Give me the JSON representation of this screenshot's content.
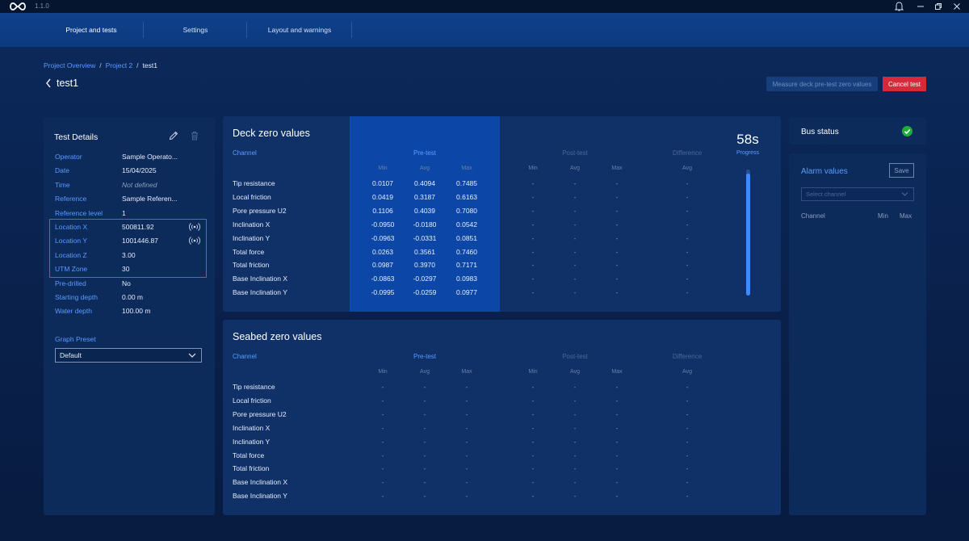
{
  "app": {
    "version": "1.1.0"
  },
  "nav": {
    "tabs": [
      {
        "label": "Project and tests"
      },
      {
        "label": "Settings"
      },
      {
        "label": "Layout and warnings"
      }
    ]
  },
  "breadcrumb": {
    "items": [
      "Project Overview",
      "Project 2",
      "test1"
    ]
  },
  "page": {
    "title": "test1"
  },
  "actions": {
    "measure_label": "Measure deck pre-test zero values",
    "cancel_label": "Cancel test"
  },
  "details": {
    "title": "Test Details",
    "rows": [
      {
        "label": "Operator",
        "value": "Sample Operato..."
      },
      {
        "label": "Date",
        "value": "15/04/2025"
      },
      {
        "label": "Time",
        "value": "Not defined"
      },
      {
        "label": "Reference",
        "value": "Sample Referen..."
      },
      {
        "label": "Reference level",
        "value": "1"
      },
      {
        "label": "Location X",
        "value": "500811.92"
      },
      {
        "label": "Location Y",
        "value": "1001446.87"
      },
      {
        "label": "Location Z",
        "value": "3.00"
      },
      {
        "label": "UTM Zone",
        "value": "30"
      },
      {
        "label": "Pre-drilled",
        "value": "No"
      },
      {
        "label": "Starting depth",
        "value": "0.00 m"
      },
      {
        "label": "Water depth",
        "value": "100.00 m"
      }
    ],
    "graph_preset_label": "Graph Preset",
    "graph_preset_value": "Default"
  },
  "deck": {
    "title": "Deck zero values",
    "headers": {
      "channel": "Channel",
      "pretest": "Pre-test",
      "posttest": "Post-test",
      "difference": "Difference",
      "min": "Min",
      "avg": "Avg",
      "max": "Max"
    },
    "rows": [
      {
        "channel": "Tip resistance",
        "min": "0.0107",
        "avg": "0.4094",
        "max": "0.7485",
        "post_min": "-",
        "post_avg": "-",
        "post_max": "-",
        "diff": "-"
      },
      {
        "channel": "Local friction",
        "min": "0.0419",
        "avg": "0.3187",
        "max": "0.6163",
        "post_min": "-",
        "post_avg": "-",
        "post_max": "-",
        "diff": "-"
      },
      {
        "channel": "Pore pressure U2",
        "min": "0.1106",
        "avg": "0.4039",
        "max": "0.7080",
        "post_min": "-",
        "post_avg": "-",
        "post_max": "-",
        "diff": "-"
      },
      {
        "channel": "Inclination X",
        "min": "-0.0950",
        "avg": "-0.0180",
        "max": "0.0542",
        "post_min": "-",
        "post_avg": "-",
        "post_max": "-",
        "diff": "-"
      },
      {
        "channel": "Inclination Y",
        "min": "-0.0963",
        "avg": "-0.0331",
        "max": "0.0851",
        "post_min": "-",
        "post_avg": "-",
        "post_max": "-",
        "diff": "-"
      },
      {
        "channel": "Total force",
        "min": "0.0263",
        "avg": "0.3561",
        "max": "0.7460",
        "post_min": "-",
        "post_avg": "-",
        "post_max": "-",
        "diff": "-"
      },
      {
        "channel": "Total friction",
        "min": "0.0987",
        "avg": "0.3970",
        "max": "0.7171",
        "post_min": "-",
        "post_avg": "-",
        "post_max": "-",
        "diff": "-"
      },
      {
        "channel": "Base Inclination X",
        "min": "-0.0863",
        "avg": "-0.0297",
        "max": "0.0983",
        "post_min": "-",
        "post_avg": "-",
        "post_max": "-",
        "diff": "-"
      },
      {
        "channel": "Base Inclination Y",
        "min": "-0.0995",
        "avg": "-0.0259",
        "max": "0.0977",
        "post_min": "-",
        "post_avg": "-",
        "post_max": "-",
        "diff": "-"
      }
    ],
    "progress": {
      "seconds": "58s",
      "label": "Progress",
      "fraction": 0.97
    }
  },
  "seabed": {
    "title": "Seabed zero values",
    "headers": {
      "channel": "Channel",
      "pretest": "Pre-test",
      "posttest": "Post-test",
      "difference": "Difference",
      "min": "Min",
      "avg": "Avg",
      "max": "Max"
    },
    "rows": [
      {
        "channel": "Tip resistance",
        "min": "-",
        "avg": "-",
        "max": "-",
        "post_min": "-",
        "post_avg": "-",
        "post_max": "-",
        "diff": "-"
      },
      {
        "channel": "Local friction",
        "min": "-",
        "avg": "-",
        "max": "-",
        "post_min": "-",
        "post_avg": "-",
        "post_max": "-",
        "diff": "-"
      },
      {
        "channel": "Pore pressure U2",
        "min": "-",
        "avg": "-",
        "max": "-",
        "post_min": "-",
        "post_avg": "-",
        "post_max": "-",
        "diff": "-"
      },
      {
        "channel": "Inclination X",
        "min": "-",
        "avg": "-",
        "max": "-",
        "post_min": "-",
        "post_avg": "-",
        "post_max": "-",
        "diff": "-"
      },
      {
        "channel": "Inclination Y",
        "min": "-",
        "avg": "-",
        "max": "-",
        "post_min": "-",
        "post_avg": "-",
        "post_max": "-",
        "diff": "-"
      },
      {
        "channel": "Total force",
        "min": "-",
        "avg": "-",
        "max": "-",
        "post_min": "-",
        "post_avg": "-",
        "post_max": "-",
        "diff": "-"
      },
      {
        "channel": "Total friction",
        "min": "-",
        "avg": "-",
        "max": "-",
        "post_min": "-",
        "post_avg": "-",
        "post_max": "-",
        "diff": "-"
      },
      {
        "channel": "Base Inclination X",
        "min": "-",
        "avg": "-",
        "max": "-",
        "post_min": "-",
        "post_avg": "-",
        "post_max": "-",
        "diff": "-"
      },
      {
        "channel": "Base Inclination Y",
        "min": "-",
        "avg": "-",
        "max": "-",
        "post_min": "-",
        "post_avg": "-",
        "post_max": "-",
        "diff": "-"
      }
    ]
  },
  "bus": {
    "title": "Bus status",
    "status_color": "#1fae3c"
  },
  "alarm": {
    "title": "Alarm values",
    "save_label": "Save",
    "select_placeholder": "Select channel",
    "col_channel": "Channel",
    "col_min": "Min",
    "col_max": "Max"
  },
  "colors": {
    "accent": "#5b9cff",
    "danger": "#d52a3a",
    "highlight": "#e23a4a"
  }
}
